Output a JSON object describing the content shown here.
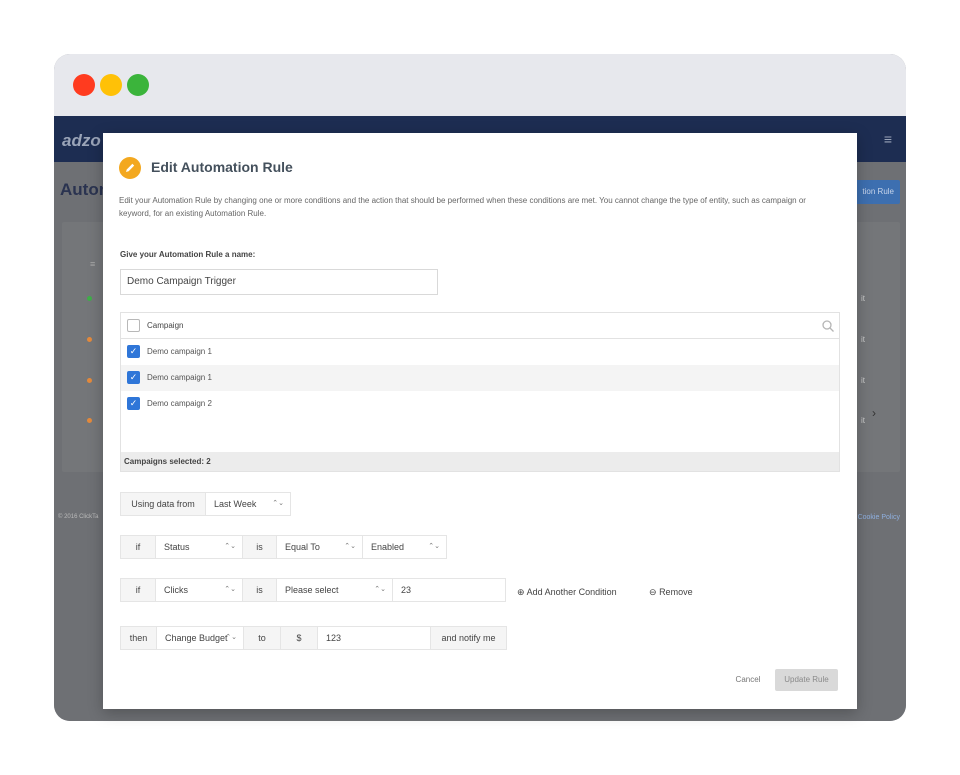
{
  "window": {
    "traffic_lights": [
      "red",
      "yellow",
      "green"
    ]
  },
  "background_app": {
    "logo": "adzo",
    "page_title": "Autom",
    "header_button": "tion Rule",
    "row_edit": "it",
    "footer_left": "© 2016 ClickTa",
    "footer_right": "Cookie Policy",
    "status_colors": [
      "#27ae60",
      "#e67e22",
      "#e67e22",
      "#e67e22"
    ]
  },
  "modal": {
    "title": "Edit Automation Rule",
    "icon": "pencil-icon",
    "description": "Edit your Automation Rule by changing one or more conditions and the action that should be performed when these conditions are met. You cannot change the type of entity, such as campaign or keyword, for an existing Automation Rule.",
    "name_label": "Give your Automation Rule a name:",
    "name_value": "Demo Campaign Trigger",
    "campaign_header": "Campaign",
    "campaigns": [
      {
        "label": "Demo campaign 1",
        "checked": true
      },
      {
        "label": "Demo campaign 1",
        "checked": true
      },
      {
        "label": "Demo campaign 2",
        "checked": true
      }
    ],
    "campaigns_selected": "Campaigns selected: 2",
    "using_data": {
      "label": "Using data from",
      "value": "Last Week"
    },
    "condition1": {
      "if": "if",
      "field": "Status",
      "is": "is",
      "operator": "Equal To",
      "value": "Enabled"
    },
    "condition2": {
      "if": "if",
      "field": "Clicks",
      "is": "is",
      "operator": "Please select",
      "value": "23"
    },
    "add_condition": "Add Another Condition",
    "remove": "Remove",
    "action": {
      "then": "then",
      "action": "Change Budget",
      "to": "to",
      "currency": "$",
      "amount": "123",
      "notify": "and notify me"
    },
    "cancel": "Cancel",
    "update": "Update Rule"
  },
  "colors": {
    "accent": "#2f76d8",
    "icon_bg": "#f3a81f",
    "header_bg": "#1d2d52"
  }
}
